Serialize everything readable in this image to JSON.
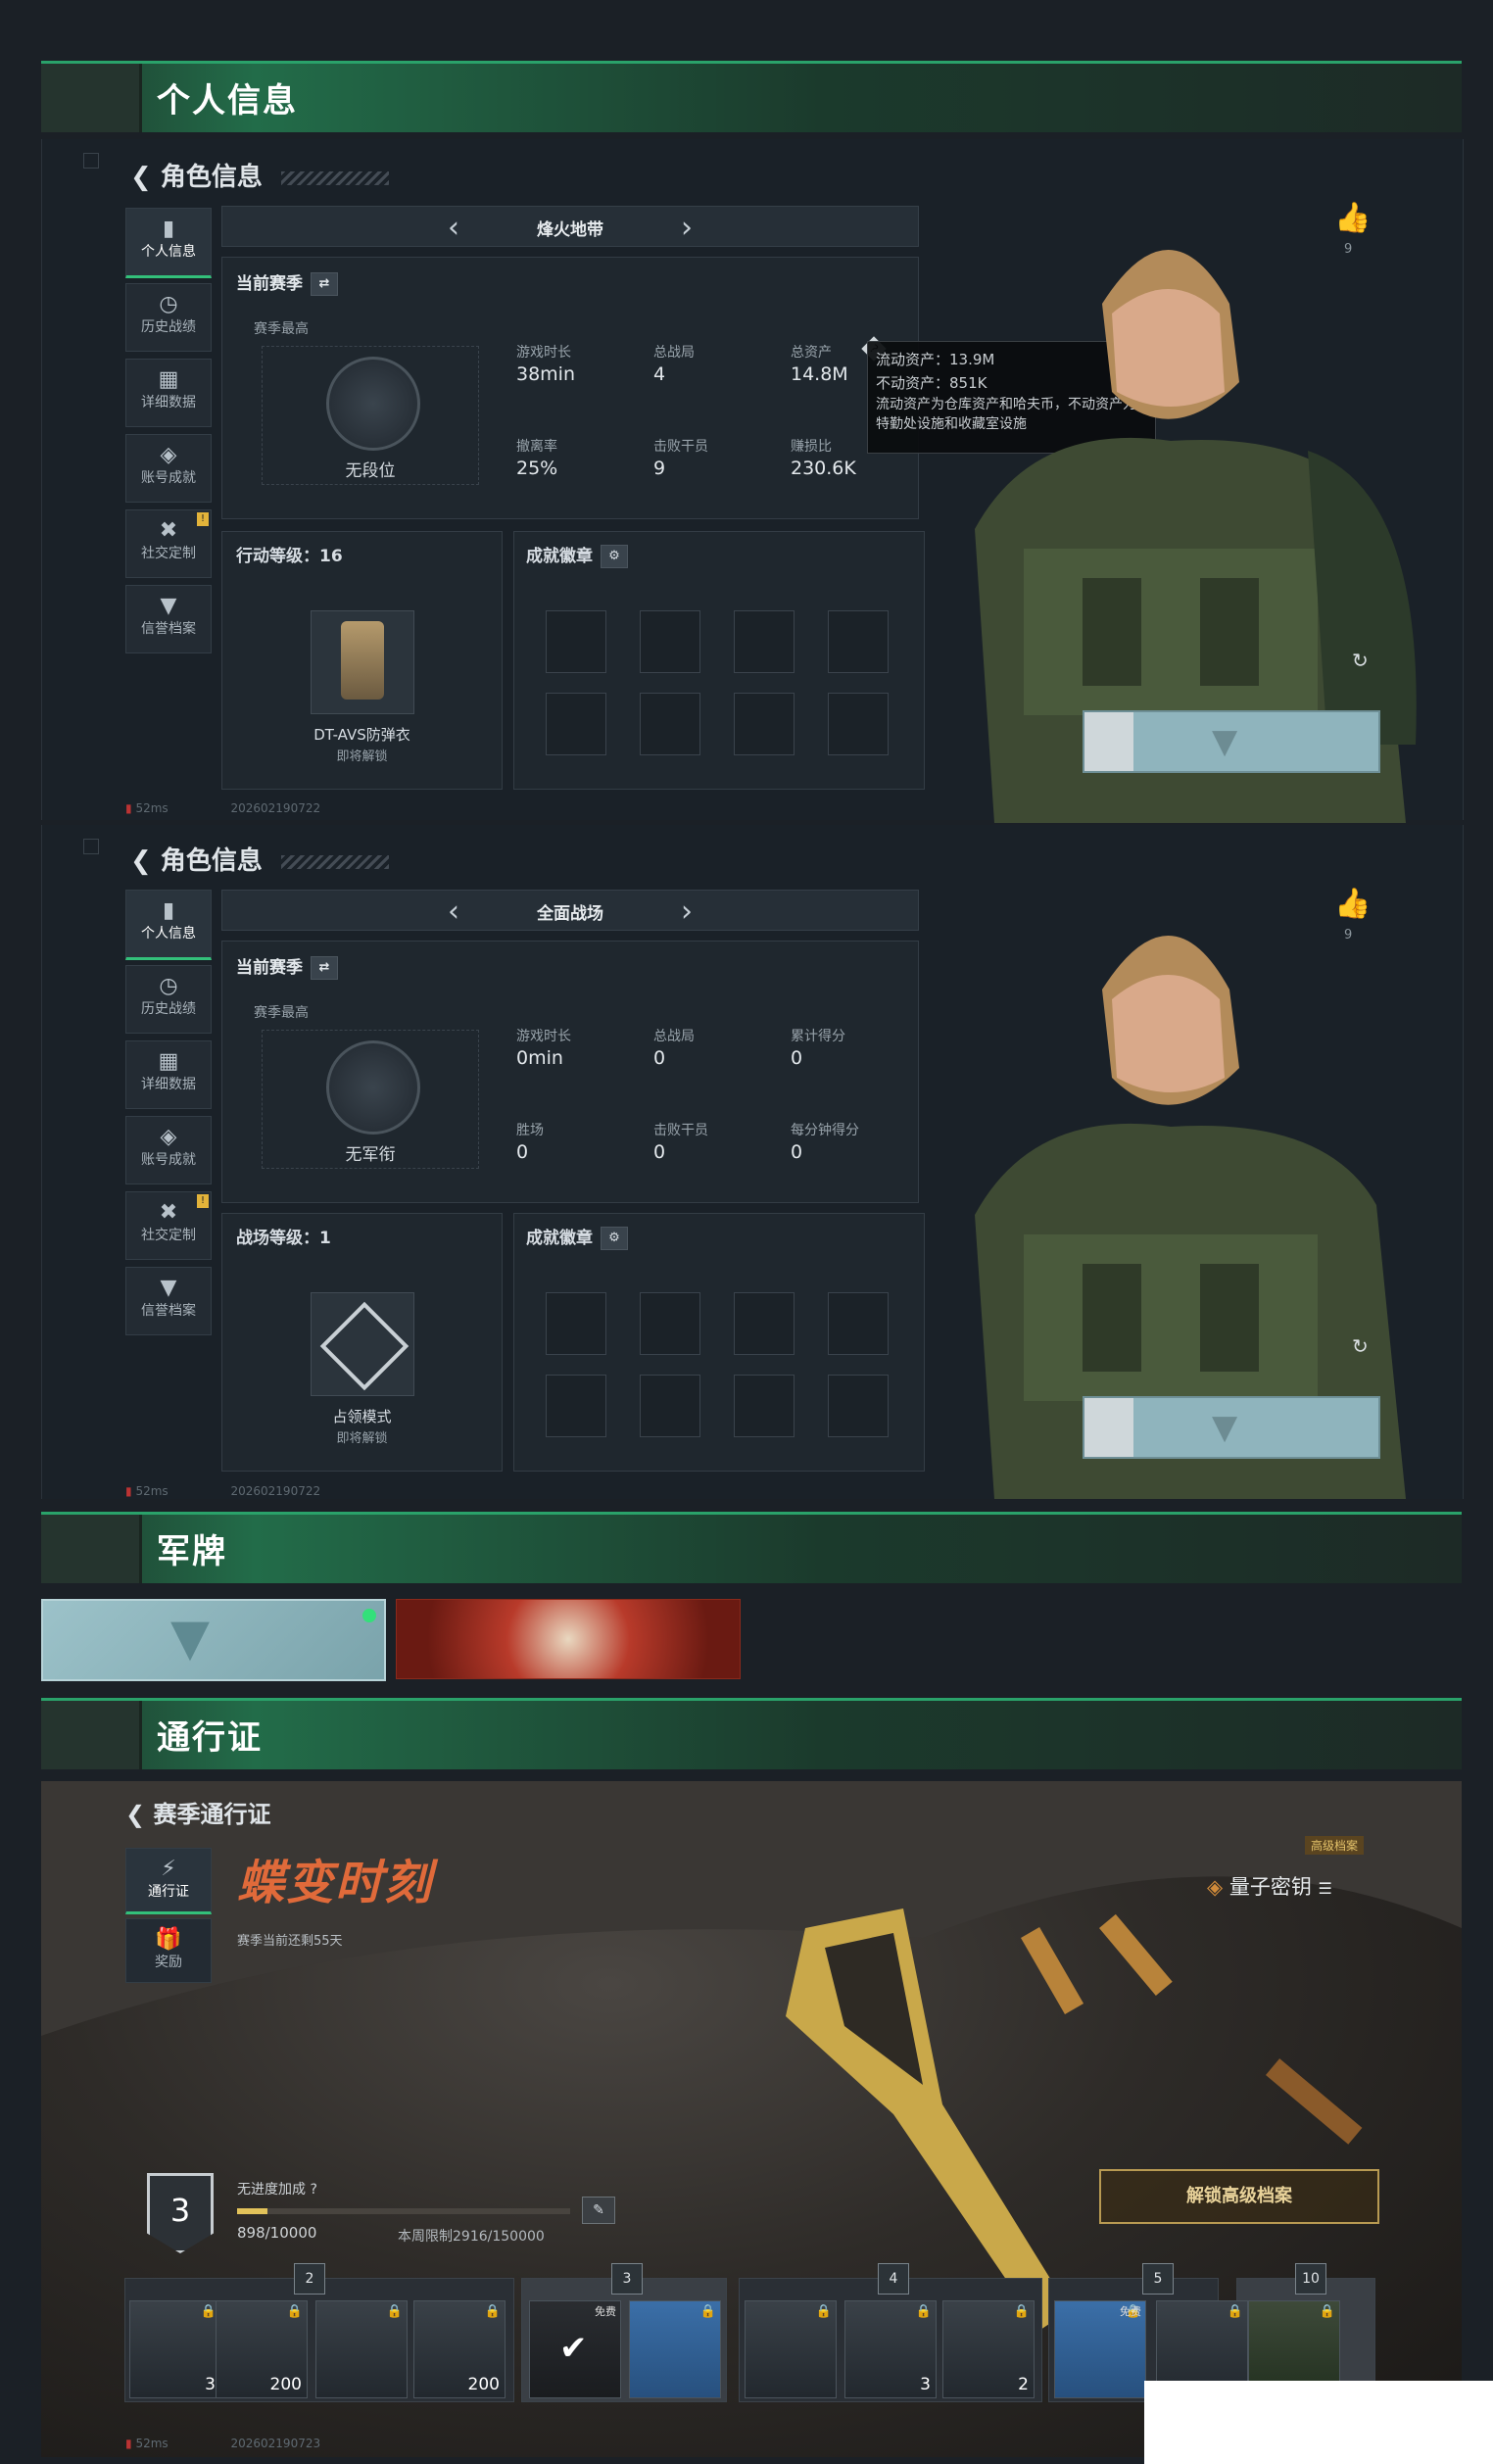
{
  "sections": {
    "personal_info": "个人信息",
    "dogtag": "军牌",
    "pass": "通行证"
  },
  "role_info_title": "角色信息",
  "sidebar": [
    {
      "label": "个人信息",
      "icon": "bar-chart-icon"
    },
    {
      "label": "历史战绩",
      "icon": "history-icon"
    },
    {
      "label": "详细数据",
      "icon": "folder-icon"
    },
    {
      "label": "账号成就",
      "icon": "medal-icon"
    },
    {
      "label": "社交定制",
      "icon": "wrench-icon",
      "badge": "!"
    },
    {
      "label": "信誉档案",
      "icon": "shield-icon"
    }
  ],
  "panel1": {
    "mode": "烽火地带",
    "season": "当前赛季",
    "season_best": "赛季最高",
    "rank": "无段位",
    "stats": [
      {
        "label": "游戏时长",
        "value": "38min"
      },
      {
        "label": "总战局",
        "value": "4"
      },
      {
        "label": "总资产",
        "value": "14.8M"
      },
      {
        "label": "撤离率",
        "value": "25%"
      },
      {
        "label": "击败干员",
        "value": "9"
      },
      {
        "label": "赚损比",
        "value": "230.6K"
      }
    ],
    "level": "行动等级：16",
    "item_name": "DT-AVS防弹衣",
    "item_sub": "即将解锁",
    "achievements": "成就徽章",
    "tooltip": {
      "line1": "流动资产：13.9M",
      "line2": "不动资产：851K",
      "line3": "流动资产为仓库资产和哈夫币，不动资产为特勤处设施和收藏室设施"
    },
    "likes": "9",
    "footer": "52ms",
    "footer_id": "202602190722"
  },
  "panel2": {
    "mode": "全面战场",
    "season": "当前赛季",
    "season_best": "赛季最高",
    "rank": "无军衔",
    "stats": [
      {
        "label": "游戏时长",
        "value": "0min"
      },
      {
        "label": "总战局",
        "value": "0"
      },
      {
        "label": "累计得分",
        "value": "0"
      },
      {
        "label": "胜场",
        "value": "0"
      },
      {
        "label": "击败干员",
        "value": "0"
      },
      {
        "label": "每分钟得分",
        "value": "0"
      }
    ],
    "level": "战场等级：1",
    "item_name": "占领模式",
    "item_sub": "即将解锁",
    "achievements": "成就徽章",
    "likes": "9",
    "footer": "52ms",
    "footer_id": "202602190722"
  },
  "pass": {
    "back": "赛季通行证",
    "tabs": [
      {
        "label": "通行证"
      },
      {
        "label": "奖励"
      }
    ],
    "event_title": "蝶变时刻",
    "remaining": "赛季当前还剩55天",
    "premium_tag": "高级档案",
    "item_title": "量子密钥",
    "level": "3",
    "progress_label": "无进度加成",
    "progress": "898/10000",
    "progress_fraction": 0.0898,
    "weekly": "本周限制2916/150000",
    "unlock_btn": "解锁高级档案",
    "markers": [
      "2",
      "3",
      "4",
      "5",
      "10"
    ],
    "free_label": "免费",
    "slot_counts": [
      "3",
      "200",
      "",
      "200",
      "",
      "",
      "",
      "3",
      "2",
      "",
      "",
      ""
    ],
    "footer": "52ms",
    "footer_id": "202602190723"
  },
  "colors": {
    "accent": "#2aa26a",
    "gold": "#c8a44a",
    "bg": "#1b2026"
  }
}
